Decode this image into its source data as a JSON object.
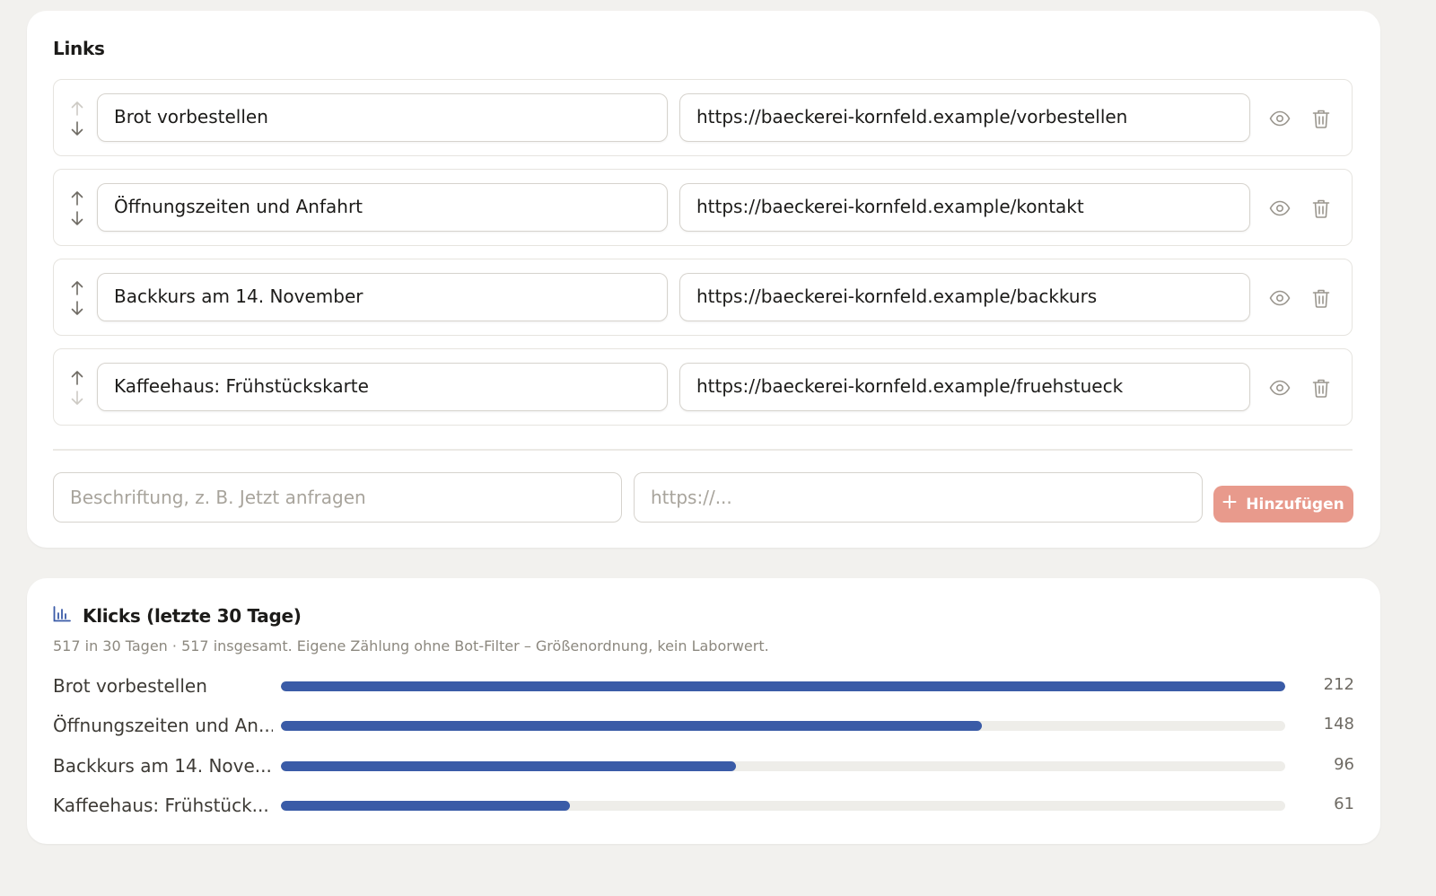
{
  "links_section": {
    "title": "Links",
    "items": [
      {
        "label": "Brot vorbestellen",
        "url": "https://baeckerei-kornfeld.example/vorbestellen",
        "can_move_up": false,
        "can_move_down": true
      },
      {
        "label": "Öffnungszeiten und Anfahrt",
        "url": "https://baeckerei-kornfeld.example/kontakt",
        "can_move_up": true,
        "can_move_down": true
      },
      {
        "label": "Backkurs am 14. November",
        "url": "https://baeckerei-kornfeld.example/backkurs",
        "can_move_up": true,
        "can_move_down": true
      },
      {
        "label": "Kaffeehaus: Frühstückskarte",
        "url": "https://baeckerei-kornfeld.example/fruehstueck",
        "can_move_up": true,
        "can_move_down": false
      }
    ],
    "new_link": {
      "label_placeholder": "Beschriftung, z. B. Jetzt anfragen",
      "url_placeholder": "https://...",
      "add_label": "Hinzufügen"
    }
  },
  "stats_section": {
    "icon": "bar-chart-icon",
    "title": "Klicks (letzte 30 Tage)",
    "subtitle": "517 in 30 Tagen · 517 insgesamt. Eigene Zählung ohne Bot-Filter – Größenordnung, kein Laborwert."
  },
  "colors": {
    "accent": "#3a5ba7",
    "add_button": "#e89a8c",
    "background": "#f2f1ee"
  },
  "chart_data": {
    "type": "bar",
    "orientation": "horizontal",
    "categories": [
      "Brot vorbestellen",
      "Öffnungszeiten und An...",
      "Backkurs am 14. Nove...",
      "Kaffeehaus: Frühstück..."
    ],
    "values": [
      212,
      148,
      96,
      61
    ],
    "xlim": [
      0,
      212
    ],
    "grid": false
  }
}
